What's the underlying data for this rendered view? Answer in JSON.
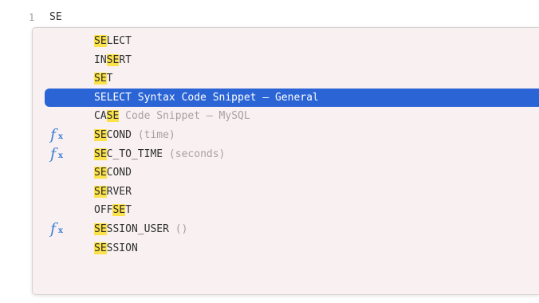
{
  "editor": {
    "line_number": "1",
    "line_text": "SE"
  },
  "autocomplete": {
    "items": [
      {
        "match": "SE",
        "rest": "LECT",
        "hint": "",
        "icon": ""
      },
      {
        "prefix": "IN",
        "match": "SE",
        "rest": "RT",
        "hint": "",
        "icon": ""
      },
      {
        "match": "SE",
        "rest": "T",
        "hint": "",
        "icon": ""
      },
      {
        "label": "SELECT Syntax Code Snippet – General",
        "selected": true,
        "icon": ""
      },
      {
        "prefix": "CA",
        "match": "SE",
        "rest": "",
        "hint": " Code Snippet – MySQL",
        "icon": ""
      },
      {
        "match": "SE",
        "rest": "COND",
        "hint": " (time)",
        "icon": "function-icon"
      },
      {
        "match": "SE",
        "rest": "C_TO_TIME",
        "hint": " (seconds)",
        "icon": "function-icon"
      },
      {
        "match": "SE",
        "rest": "COND",
        "hint": "",
        "icon": ""
      },
      {
        "match": "SE",
        "rest": "RVER",
        "hint": "",
        "icon": ""
      },
      {
        "prefix": "OFF",
        "match": "SE",
        "rest": "T",
        "hint": "",
        "icon": ""
      },
      {
        "match": "SE",
        "rest": "SSION_USER",
        "hint": " ()",
        "icon": "function-icon"
      },
      {
        "match": "SE",
        "rest": "SSION",
        "hint": "",
        "icon": ""
      }
    ],
    "icon_glyph": {
      "f": "f",
      "x": "x"
    }
  },
  "colors": {
    "selection": "#2a64d5",
    "match_highlight": "#fbe24a",
    "popup_background": "#f9f1f1",
    "function_icon": "#3e7fd6"
  }
}
